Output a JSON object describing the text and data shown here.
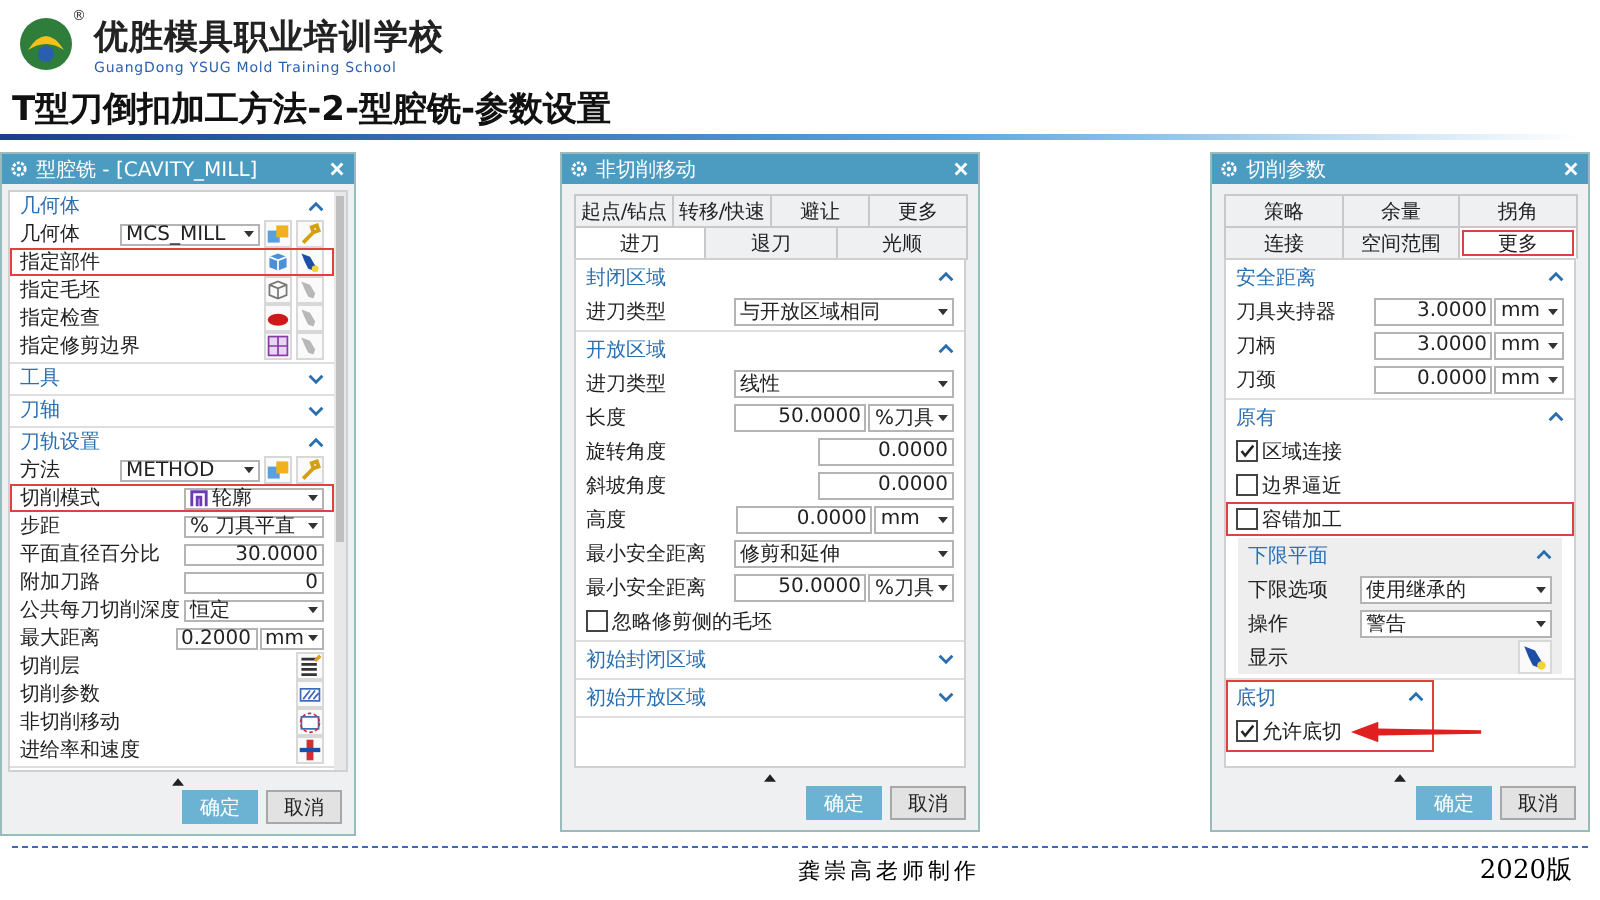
{
  "header": {
    "school_name": "优胜模具职业培训学校",
    "school_subtitle": "GuangDong YSUG Mold Training School",
    "reg_mark": "®",
    "title": "T型刀倒扣加工方法-2-型腔铣-参数设置"
  },
  "dialogs": [
    {
      "title": "型腔铣 - [CAVITY_MILL]",
      "scrollbar": true,
      "sections": [
        {
          "title": "几何体",
          "expanded": true,
          "rows": [
            {
              "kind": "select_tools",
              "label": "几何体",
              "value": "MCS_MILL"
            },
            {
              "kind": "pick",
              "label": "指定部件",
              "highlighted": true
            },
            {
              "kind": "pick",
              "label": "指定毛坯",
              "highlighted": false
            },
            {
              "kind": "pick",
              "label": "指定检查",
              "highlighted": false
            },
            {
              "kind": "pick",
              "label": "指定修剪边界",
              "highlighted": false
            }
          ]
        },
        {
          "title": "工具",
          "expanded": false
        },
        {
          "title": "刀轴",
          "expanded": false
        },
        {
          "title": "刀轨设置",
          "expanded": true,
          "rows": [
            {
              "kind": "select_tools",
              "label": "方法",
              "value": "METHOD"
            },
            {
              "kind": "mode_select",
              "label": "切削模式",
              "value": "轮廓",
              "highlighted": true
            },
            {
              "kind": "select",
              "label": "步距",
              "value": "% 刀具平直"
            },
            {
              "kind": "input",
              "label": "平面直径百分比",
              "value": "30.0000"
            },
            {
              "kind": "input",
              "label": "附加刀路",
              "value": "0"
            },
            {
              "kind": "select",
              "label": "公共每刀切削深度",
              "value": "恒定"
            },
            {
              "kind": "input",
              "label": "最大距离",
              "value": "0.2000",
              "unit": "mm"
            },
            {
              "kind": "action",
              "label": "切削层"
            },
            {
              "kind": "action",
              "label": "切削参数"
            },
            {
              "kind": "action",
              "label": "非切削移动"
            },
            {
              "kind": "action",
              "label": "进给率和速度"
            }
          ]
        }
      ],
      "buttons": [
        {
          "label": "确定",
          "kind": "primary"
        },
        {
          "label": "取消",
          "kind": "default"
        }
      ]
    },
    {
      "title": "非切削移动",
      "tab_rows": [
        [
          {
            "label": "起点/钻点",
            "selected": false
          },
          {
            "label": "转移/快速",
            "selected": false
          },
          {
            "label": "避让",
            "selected": false
          },
          {
            "label": "更多",
            "selected": false
          }
        ],
        [
          {
            "label": "进刀",
            "selected": true
          },
          {
            "label": "退刀",
            "selected": false
          },
          {
            "label": "光顺",
            "selected": false
          }
        ]
      ],
      "sections": [
        {
          "title": "封闭区域",
          "expanded": true,
          "rows": [
            {
              "kind": "select",
              "label": "进刀类型",
              "value": "与开放区域相同"
            }
          ]
        },
        {
          "title": "开放区域",
          "expanded": true,
          "rows": [
            {
              "kind": "select",
              "label": "进刀类型",
              "value": "线性"
            },
            {
              "kind": "input",
              "label": "长度",
              "value": "50.0000",
              "unit": "%刀具"
            },
            {
              "kind": "input",
              "label": "旋转角度",
              "value": "0.0000"
            },
            {
              "kind": "input",
              "label": "斜坡角度",
              "value": "0.0000"
            },
            {
              "kind": "input",
              "label": "高度",
              "value": "0.0000",
              "unit": "mm"
            },
            {
              "kind": "select",
              "label": "最小安全距离",
              "value": "修剪和延伸"
            },
            {
              "kind": "input",
              "label": "最小安全距离",
              "value": "50.0000",
              "unit": "%刀具"
            },
            {
              "kind": "check",
              "label": "忽略修剪侧的毛坯",
              "checked": false
            }
          ]
        },
        {
          "title": "初始封闭区域",
          "expanded": false
        },
        {
          "title": "初始开放区域",
          "expanded": false
        }
      ],
      "buttons": [
        {
          "label": "确定",
          "kind": "primary"
        },
        {
          "label": "取消",
          "kind": "default"
        }
      ]
    },
    {
      "title": "切削参数",
      "tab_rows": [
        [
          {
            "label": "策略",
            "selected": false
          },
          {
            "label": "余量",
            "selected": false
          },
          {
            "label": "拐角",
            "selected": false
          }
        ],
        [
          {
            "label": "连接",
            "selected": false
          },
          {
            "label": "空间范围",
            "selected": false
          },
          {
            "label": "更多",
            "selected": true,
            "highlighted": true
          }
        ]
      ],
      "sections": [
        {
          "title": "安全距离",
          "expanded": true,
          "rows": [
            {
              "kind": "input",
              "label": "刀具夹持器",
              "value": "3.0000",
              "unit": "mm"
            },
            {
              "kind": "input",
              "label": "刀柄",
              "value": "3.0000",
              "unit": "mm"
            },
            {
              "kind": "input",
              "label": "刀颈",
              "value": "0.0000",
              "unit": "mm"
            }
          ]
        },
        {
          "title": "原有",
          "expanded": true,
          "rows": [
            {
              "kind": "check",
              "label": "区域连接",
              "checked": true
            },
            {
              "kind": "check",
              "label": "边界逼近",
              "checked": false
            },
            {
              "kind": "check",
              "label": "容错加工",
              "checked": false,
              "highlighted": true
            },
            {
              "kind": "subsection",
              "title": "下限平面",
              "expanded": true,
              "rows": [
                {
                  "kind": "select",
                  "label": "下限选项",
                  "value": "使用继承的"
                },
                {
                  "kind": "select",
                  "label": "操作",
                  "value": "警告"
                },
                {
                  "kind": "action",
                  "label": "显示"
                }
              ]
            }
          ]
        },
        {
          "title": "底切",
          "expanded": true,
          "highlighted": true,
          "pointer_arrow": true,
          "rows": [
            {
              "kind": "check",
              "label": "允许底切",
              "checked": true
            }
          ]
        }
      ],
      "buttons": [
        {
          "label": "确定",
          "kind": "primary"
        },
        {
          "label": "取消",
          "kind": "default"
        }
      ]
    }
  ],
  "footer": {
    "author": "龚崇高老师制作",
    "version": "2020版"
  }
}
